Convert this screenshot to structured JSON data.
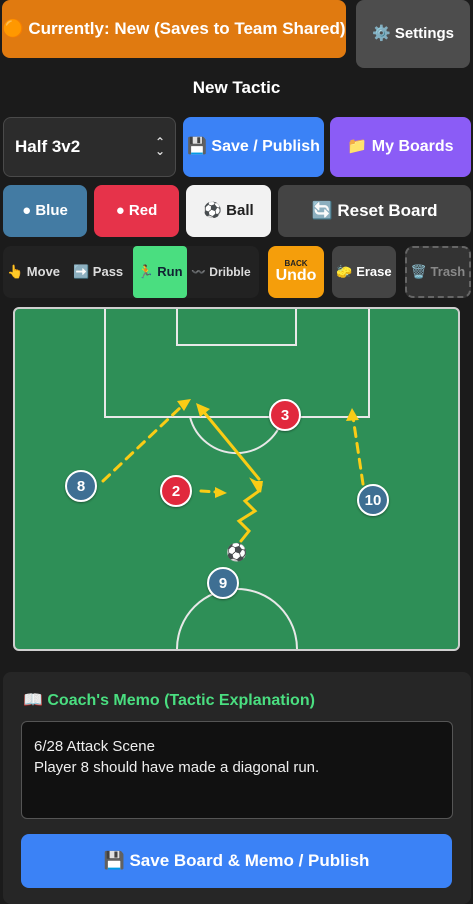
{
  "header": {
    "status_label": "🟠 Currently: New (Saves to Team Shared)",
    "settings_label": "⚙️ Settings",
    "page_title": "New Tactic"
  },
  "controls": {
    "formation_selected": "Half 3v2",
    "save_label": "💾 Save / Publish",
    "boards_label": "📁 My Boards"
  },
  "colors_row": {
    "blue_label": "● Blue",
    "red_label": "● Red",
    "ball_label": "⚽ Ball",
    "reset_label": "🔄 Reset Board"
  },
  "tools": {
    "move_label": "👆 Move",
    "pass_label": "➡️ Pass",
    "run_label": "🏃 Run",
    "dribble_label": "〰️ Dribble",
    "undo_back": "BACK",
    "undo_label": "Undo",
    "erase_label": "🧽 Erase",
    "trash_label": "🗑️ Trash",
    "active_tool": "Run"
  },
  "board": {
    "players": [
      {
        "team": "blue",
        "number": "8"
      },
      {
        "team": "red",
        "number": "2"
      },
      {
        "team": "red",
        "number": "3"
      },
      {
        "team": "blue",
        "number": "10"
      },
      {
        "team": "blue",
        "number": "9"
      }
    ],
    "ball": "⚽",
    "field_color": "#2e8f57",
    "arrow_color": "#facc15"
  },
  "memo": {
    "heading": "📖 Coach's Memo (Tactic Explanation)",
    "line1": "6/28 Attack Scene",
    "line2": "Player 8 should have made a diagonal run.",
    "publish_label": "💾 Save Board & Memo / Publish"
  },
  "theme": {
    "background": "#1b1b1b",
    "status_orange": "#e07a10",
    "primary_blue": "#3b82f6",
    "purple": "#8b5cf6",
    "team_blue": "#3e6f93",
    "team_red": "#e1293d",
    "run_green": "#4ade80",
    "undo_amber": "#f59e0b"
  }
}
